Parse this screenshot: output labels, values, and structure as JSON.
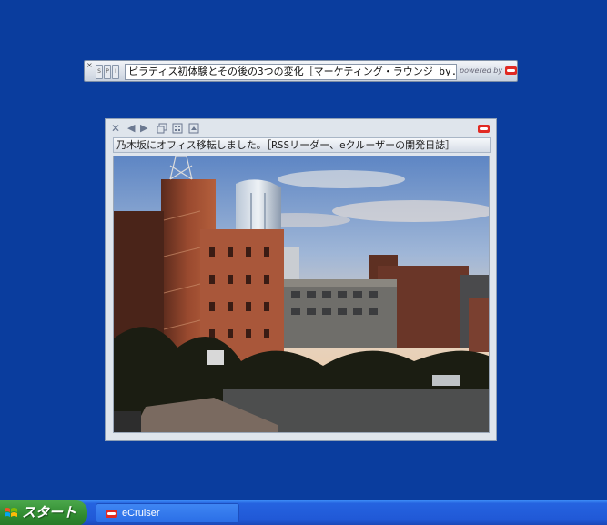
{
  "ticker": {
    "close_glyph": "×",
    "buttons": [
      "S",
      "P",
      "I"
    ],
    "headline": "ピラティス初体験とその後の3つの変化［マーケティング・ラウンジ by..",
    "powered_by": "powered by"
  },
  "viewer": {
    "toolbar": {
      "close_glyph": "✕",
      "back_glyph": "◀",
      "forward_glyph": "▶"
    },
    "title": "乃木坂にオフィス移転しました。［RSSリーダー、eクルーザーの開発日誌］"
  },
  "taskbar": {
    "start_label": "スタート",
    "item_label": "eCruiser"
  },
  "colors": {
    "desktop": "#0a3d9e",
    "brand_red": "#e12a23",
    "start_green": "#2f8a2f",
    "taskbar_blue": "#2058d6"
  }
}
